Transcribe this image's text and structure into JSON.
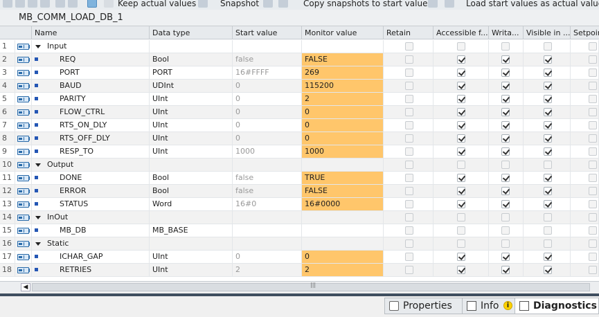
{
  "toolbar": {
    "keep_actual": "Keep actual values",
    "snapshot": "Snapshot",
    "copy_snapshots": "Copy snapshots to start values",
    "load_start": "Load start values as actual values"
  },
  "block_title": "MB_COMM_LOAD_DB_1",
  "columns": {
    "name": "Name",
    "type": "Data type",
    "start": "Start value",
    "monitor": "Monitor value",
    "retain": "Retain",
    "accessible": "Accessible f...",
    "writable": "Writa...",
    "visible": "Visible in ...",
    "setpoint": "Setpoint"
  },
  "rows": [
    {
      "num": "1",
      "name": "Input",
      "type": "",
      "start": "",
      "monitor": "",
      "level": 0,
      "expand": true
    },
    {
      "num": "2",
      "name": "REQ",
      "type": "Bool",
      "start": "false",
      "monitor": "FALSE",
      "level": 1
    },
    {
      "num": "3",
      "name": "PORT",
      "type": "PORT",
      "start": "16#FFFF",
      "monitor": "269",
      "level": 1
    },
    {
      "num": "4",
      "name": "BAUD",
      "type": "UDInt",
      "start": "0",
      "monitor": "115200",
      "level": 1
    },
    {
      "num": "5",
      "name": "PARITY",
      "type": "UInt",
      "start": "0",
      "monitor": "2",
      "level": 1
    },
    {
      "num": "6",
      "name": "FLOW_CTRL",
      "type": "UInt",
      "start": "0",
      "monitor": "0",
      "level": 1
    },
    {
      "num": "7",
      "name": "RTS_ON_DLY",
      "type": "UInt",
      "start": "0",
      "monitor": "0",
      "level": 1
    },
    {
      "num": "8",
      "name": "RTS_OFF_DLY",
      "type": "UInt",
      "start": "0",
      "monitor": "0",
      "level": 1
    },
    {
      "num": "9",
      "name": "RESP_TO",
      "type": "UInt",
      "start": "1000",
      "monitor": "1000",
      "level": 1
    },
    {
      "num": "10",
      "name": "Output",
      "type": "",
      "start": "",
      "monitor": "",
      "level": 0,
      "expand": true
    },
    {
      "num": "11",
      "name": "DONE",
      "type": "Bool",
      "start": "false",
      "monitor": "TRUE",
      "level": 1
    },
    {
      "num": "12",
      "name": "ERROR",
      "type": "Bool",
      "start": "false",
      "monitor": "FALSE",
      "level": 1
    },
    {
      "num": "13",
      "name": "STATUS",
      "type": "Word",
      "start": "16#0",
      "monitor": "16#0000",
      "level": 1
    },
    {
      "num": "14",
      "name": "InOut",
      "type": "",
      "start": "",
      "monitor": "",
      "level": 0,
      "expand": true
    },
    {
      "num": "15",
      "name": "MB_DB",
      "type": "MB_BASE",
      "start": "",
      "monitor": "",
      "level": 1
    },
    {
      "num": "16",
      "name": "Static",
      "type": "",
      "start": "",
      "monitor": "",
      "level": 0,
      "expand": true
    },
    {
      "num": "17",
      "name": "ICHAR_GAP",
      "type": "UInt",
      "start": "0",
      "monitor": "0",
      "level": 1
    },
    {
      "num": "18",
      "name": "RETRIES",
      "type": "UInt",
      "start": "2",
      "monitor": "2",
      "level": 1
    }
  ],
  "bottom_tabs": {
    "properties": "Properties",
    "info": "Info",
    "diagnostics": "Diagnostics"
  }
}
